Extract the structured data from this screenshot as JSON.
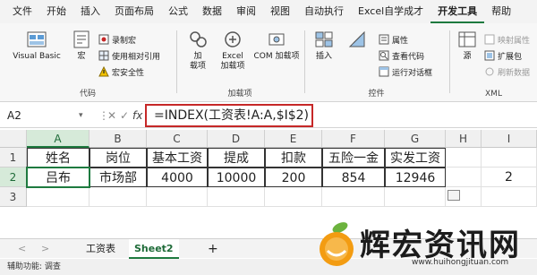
{
  "menu": {
    "items": [
      "文件",
      "开始",
      "插入",
      "页面布局",
      "公式",
      "数据",
      "审阅",
      "视图",
      "自动执行",
      "Excel自学成才",
      "开发工具",
      "帮助"
    ],
    "active_index": 10
  },
  "ribbon": {
    "code_group": {
      "label": "代码",
      "visual_basic": "Visual Basic",
      "macro": "宏",
      "record_macro": "录制宏",
      "relative_ref": "使用相对引用",
      "macro_security": "宏安全性"
    },
    "addins_group": {
      "label": "加载项",
      "addins": "加\n载项",
      "excel_addins": "Excel\n加载项",
      "com_addins": "COM 加载项"
    },
    "controls_group": {
      "label": "控件",
      "insert": "插入",
      "design_mode": "设计模式",
      "properties": "属性",
      "view_code": "查看代码",
      "run_dialog": "运行对话框"
    },
    "xml_group": {
      "label": "XML",
      "source": "源",
      "map_props": "映射属性",
      "expansion_packs": "扩展包",
      "refresh_data": "刷新数据"
    }
  },
  "formula_bar": {
    "name_box": "A2",
    "cancel": "✕",
    "confirm": "✓",
    "fx": "fx",
    "formula": "=INDEX(工资表!A:A,$I$2)"
  },
  "grid": {
    "columns": [
      "A",
      "B",
      "C",
      "D",
      "E",
      "F",
      "G",
      "H",
      "I"
    ],
    "rows": [
      "1",
      "2",
      "3"
    ],
    "row1": [
      "姓名",
      "岗位",
      "基本工资",
      "提成",
      "扣款",
      "五险一金",
      "实发工资",
      "",
      ""
    ],
    "row2": [
      "吕布",
      "市场部",
      "4000",
      "10000",
      "200",
      "854",
      "12946",
      "",
      "2"
    ]
  },
  "sheet_tabs": {
    "prev": "<",
    "next": ">",
    "tabs": [
      "工资表",
      "Sheet2"
    ],
    "active_index": 1,
    "add": "+"
  },
  "status_bar": {
    "accessibility": "辅助功能: 调查"
  },
  "watermark": {
    "text": "辉宏资讯网",
    "url": "www.huihongjituan.com"
  },
  "colors": {
    "accent": "#1e7a3f",
    "formula_highlight": "#c62828"
  }
}
